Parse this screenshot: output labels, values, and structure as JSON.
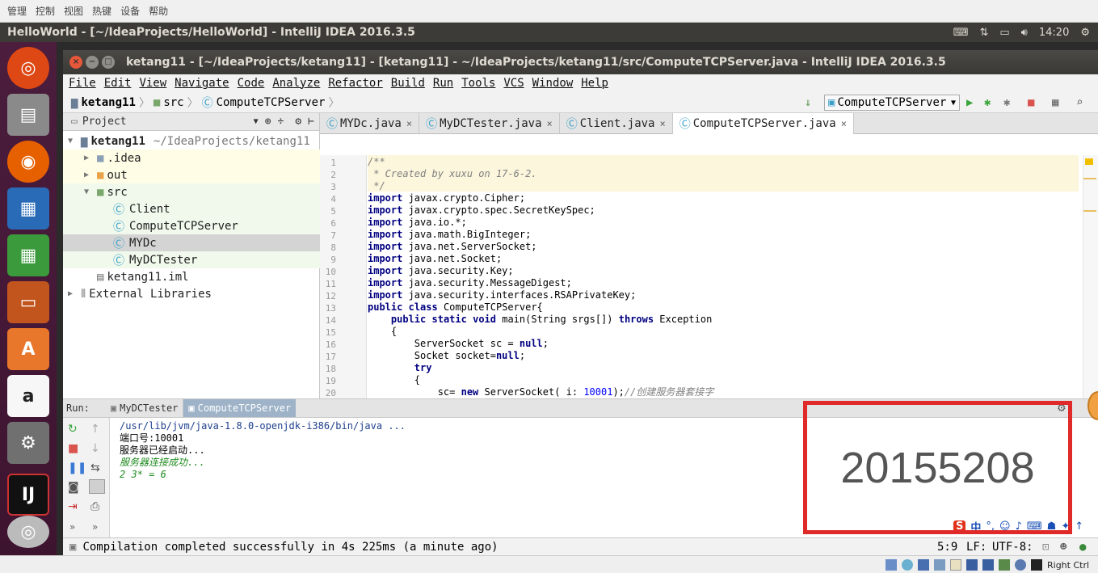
{
  "vbox_menu": {
    "items": [
      "管理",
      "控制",
      "视图",
      "热键",
      "设备",
      "帮助"
    ]
  },
  "ubuntu_top": {
    "title": "HelloWorld - [~/IdeaProjects/HelloWorld] - IntelliJ IDEA 2016.3.5",
    "time": "14:20"
  },
  "idea": {
    "window_title": "ketang11 - [~/IdeaProjects/ketang11] - [ketang11] - ~/IdeaProjects/ketang11/src/ComputeTCPServer.java - IntelliJ IDEA 2016.3.5",
    "menu": [
      "File",
      "Edit",
      "View",
      "Navigate",
      "Code",
      "Analyze",
      "Refactor",
      "Build",
      "Run",
      "Tools",
      "VCS",
      "Window",
      "Help"
    ],
    "breadcrumb": [
      "ketang11",
      "src",
      "ComputeTCPServer"
    ],
    "run_config": "ComputeTCPServer",
    "project_pane": {
      "title": "Project",
      "tree": [
        {
          "label": "ketang11",
          "suffix": "~/IdeaProjects/ketang11"
        },
        {
          "label": ".idea"
        },
        {
          "label": "out"
        },
        {
          "label": "src"
        },
        {
          "label": "Client"
        },
        {
          "label": "ComputeTCPServer"
        },
        {
          "label": "MYDc"
        },
        {
          "label": "MyDCTester"
        },
        {
          "label": "ketang11.iml"
        },
        {
          "label": "External Libraries"
        }
      ]
    },
    "tabs": [
      {
        "label": "MYDc.java"
      },
      {
        "label": "MyDCTester.java"
      },
      {
        "label": "Client.java"
      },
      {
        "label": "ComputeTCPServer.java"
      }
    ],
    "code_lines": [
      {
        "n": "1",
        "t": "/**"
      },
      {
        "n": "2",
        "t": " * Created by xuxu on 17-6-2."
      },
      {
        "n": "3",
        "t": " */"
      },
      {
        "n": "4",
        "t": "import javax.crypto.Cipher;"
      },
      {
        "n": "5",
        "t": "import javax.crypto.spec.SecretKeySpec;"
      },
      {
        "n": "6",
        "t": "import java.io.*;"
      },
      {
        "n": "7",
        "t": "import java.math.BigInteger;"
      },
      {
        "n": "8",
        "t": "import java.net.ServerSocket;"
      },
      {
        "n": "9",
        "t": "import java.net.Socket;"
      },
      {
        "n": "10",
        "t": "import java.security.Key;"
      },
      {
        "n": "11",
        "t": "import java.security.MessageDigest;"
      },
      {
        "n": "12",
        "t": "import java.security.interfaces.RSAPrivateKey;"
      },
      {
        "n": "13",
        "t": "public class ComputeTCPServer{"
      },
      {
        "n": "14",
        "t": "    public static void main(String srgs[]) throws Exception"
      },
      {
        "n": "15",
        "t": "    {"
      },
      {
        "n": "16",
        "t": "        ServerSocket sc = null;"
      },
      {
        "n": "17",
        "t": "        Socket socket=null;"
      },
      {
        "n": "18",
        "t": "        try"
      },
      {
        "n": "19",
        "t": "        {"
      },
      {
        "n": "20",
        "t": "            sc= new ServerSocket( i: 10001);//创建服务器套接字"
      }
    ],
    "run": {
      "label": "Run:",
      "tabs": [
        "MyDCTester",
        "ComputeTCPServer"
      ],
      "console": [
        "/usr/lib/jvm/java-1.8.0-openjdk-i386/bin/java ...",
        "端口号:10001",
        "服务器已经启动...",
        "服务器连接成功...",
        "2 3* = 6"
      ]
    },
    "status": {
      "message": "Compilation completed successfully in 4s 225ms (a minute ago)",
      "position": "5:9",
      "line_sep": "LF:",
      "encoding": "UTF-8:"
    },
    "ime": {
      "label": "中"
    }
  },
  "overlay": {
    "student_id": "20155208"
  },
  "vbox_bottom": {
    "host_key": "Right Ctrl"
  }
}
